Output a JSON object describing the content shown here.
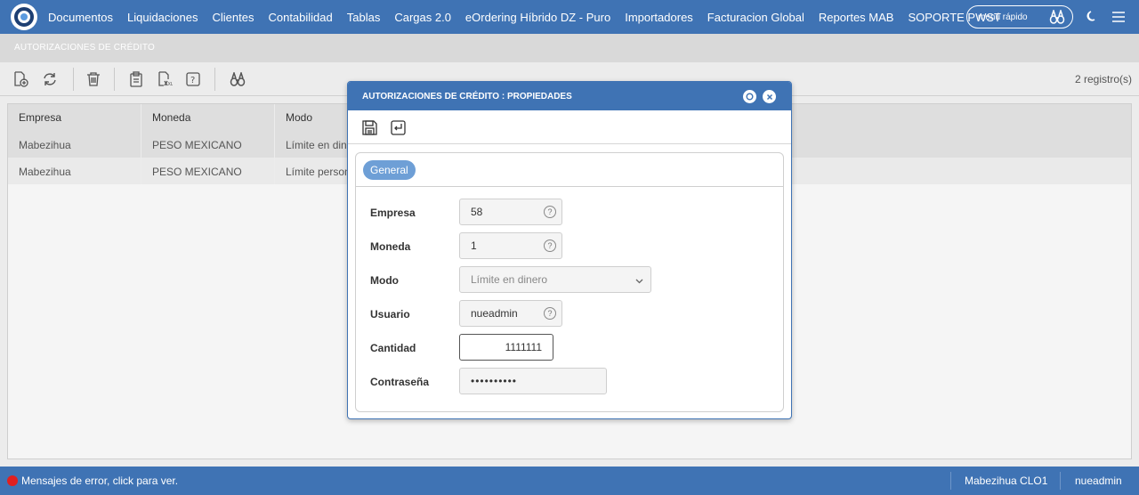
{
  "nav": {
    "items": [
      "Documentos",
      "Liquidaciones",
      "Clientes",
      "Contabilidad",
      "Tablas",
      "Cargas 2.0",
      "eOrdering Híbrido DZ - Puro",
      "Importadores",
      "Facturacion Global",
      "Reportes MAB",
      "SOPORTE PWST"
    ],
    "quick_menu": "menú rápido"
  },
  "page": {
    "subtitle": "AUTORIZACIONES DE CRÉDITO",
    "records": "2 registro(s)"
  },
  "grid": {
    "columns": [
      "Empresa",
      "Moneda",
      "Modo"
    ],
    "rows": [
      [
        "Mabezihua",
        "PESO MEXICANO",
        "Límite en dinero"
      ],
      [
        "Mabezihua",
        "PESO MEXICANO",
        "Límite personal"
      ]
    ]
  },
  "dialog": {
    "title": "AUTORIZACIONES DE CRÉDITO : PROPIEDADES",
    "tab": "General",
    "fields": {
      "empresa_label": "Empresa",
      "empresa_value": "58",
      "moneda_label": "Moneda",
      "moneda_value": "1",
      "modo_label": "Modo",
      "modo_value": "Límite en dinero",
      "usuario_label": "Usuario",
      "usuario_value": "nueadmin",
      "cantidad_label": "Cantidad",
      "cantidad_value": "1111111",
      "contrasena_label": "Contraseña",
      "contrasena_value": "••••••••••"
    }
  },
  "status": {
    "message": "Mensajes de error, click para ver.",
    "company": "Mabezihua CLO1",
    "user": "nueadmin"
  },
  "colors": {
    "primary": "#3f73b4",
    "tab": "#6e9fd6",
    "error_dot": "#e02020"
  }
}
